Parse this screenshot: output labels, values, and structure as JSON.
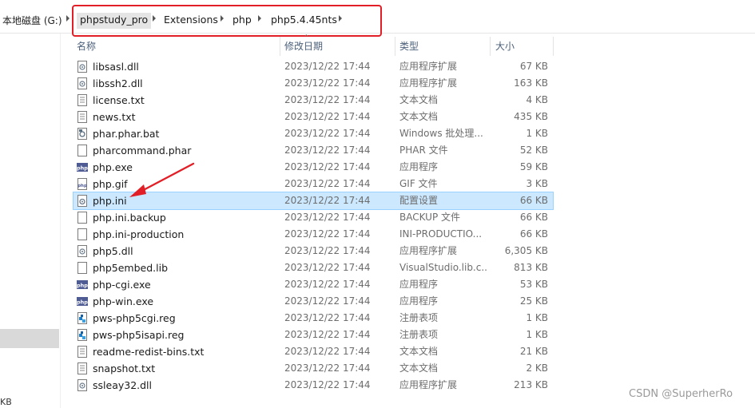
{
  "address": {
    "drive": "本地磁盘 (G:)",
    "crumbs": [
      "phpstudy_pro",
      "Extensions",
      "php",
      "php5.4.45nts"
    ]
  },
  "columns": {
    "name": "名称",
    "date": "修改日期",
    "type": "类型",
    "size": "大小"
  },
  "files": [
    {
      "name": "libsasl.dll",
      "date": "2023/12/22 17:44",
      "type": "应用程序扩展",
      "size": "67 KB",
      "icon": "dll-icon"
    },
    {
      "name": "libssh2.dll",
      "date": "2023/12/22 17:44",
      "type": "应用程序扩展",
      "size": "163 KB",
      "icon": "dll-icon"
    },
    {
      "name": "license.txt",
      "date": "2023/12/22 17:44",
      "type": "文本文档",
      "size": "4 KB",
      "icon": "text-file-icon"
    },
    {
      "name": "news.txt",
      "date": "2023/12/22 17:44",
      "type": "文本文档",
      "size": "435 KB",
      "icon": "text-file-icon"
    },
    {
      "name": "phar.phar.bat",
      "date": "2023/12/22 17:44",
      "type": "Windows 批处理...",
      "size": "1 KB",
      "icon": "batch-file-icon"
    },
    {
      "name": "pharcommand.phar",
      "date": "2023/12/22 17:44",
      "type": "PHAR 文件",
      "size": "52 KB",
      "icon": "blank-file-icon"
    },
    {
      "name": "php.exe",
      "date": "2023/12/22 17:44",
      "type": "应用程序",
      "size": "59 KB",
      "icon": "php-exe-icon"
    },
    {
      "name": "php.gif",
      "date": "2023/12/22 17:44",
      "type": "GIF 文件",
      "size": "3 KB",
      "icon": "image-file-icon"
    },
    {
      "name": "php.ini",
      "date": "2023/12/22 17:44",
      "type": "配置设置",
      "size": "66 KB",
      "icon": "config-file-icon"
    },
    {
      "name": "php.ini.backup",
      "date": "2023/12/22 17:44",
      "type": "BACKUP 文件",
      "size": "66 KB",
      "icon": "blank-file-icon"
    },
    {
      "name": "php.ini-production",
      "date": "2023/12/22 17:44",
      "type": "INI-PRODUCTIO...",
      "size": "66 KB",
      "icon": "blank-file-icon"
    },
    {
      "name": "php5.dll",
      "date": "2023/12/22 17:44",
      "type": "应用程序扩展",
      "size": "6,305 KB",
      "icon": "dll-icon"
    },
    {
      "name": "php5embed.lib",
      "date": "2023/12/22 17:44",
      "type": "VisualStudio.lib.c...",
      "size": "813 KB",
      "icon": "blank-file-icon"
    },
    {
      "name": "php-cgi.exe",
      "date": "2023/12/22 17:44",
      "type": "应用程序",
      "size": "53 KB",
      "icon": "php-exe-icon"
    },
    {
      "name": "php-win.exe",
      "date": "2023/12/22 17:44",
      "type": "应用程序",
      "size": "25 KB",
      "icon": "php-exe-icon"
    },
    {
      "name": "pws-php5cgi.reg",
      "date": "2023/12/22 17:44",
      "type": "注册表项",
      "size": "1 KB",
      "icon": "registry-file-icon"
    },
    {
      "name": "pws-php5isapi.reg",
      "date": "2023/12/22 17:44",
      "type": "注册表项",
      "size": "1 KB",
      "icon": "registry-file-icon"
    },
    {
      "name": "readme-redist-bins.txt",
      "date": "2023/12/22 17:44",
      "type": "文本文档",
      "size": "21 KB",
      "icon": "text-file-icon"
    },
    {
      "name": "snapshot.txt",
      "date": "2023/12/22 17:44",
      "type": "文本文档",
      "size": "2 KB",
      "icon": "text-file-icon"
    },
    {
      "name": "ssleay32.dll",
      "date": "2023/12/22 17:44",
      "type": "应用程序扩展",
      "size": "213 KB",
      "icon": "dll-icon"
    }
  ],
  "selected_index": 8,
  "status_fragment": "KB",
  "watermark": "CSDN @SuperherRo",
  "colors": {
    "selection_bg": "#cce8ff",
    "selection_border": "#99d1ff",
    "annotation_red": "#e21f26",
    "header_text": "#4c607a"
  }
}
